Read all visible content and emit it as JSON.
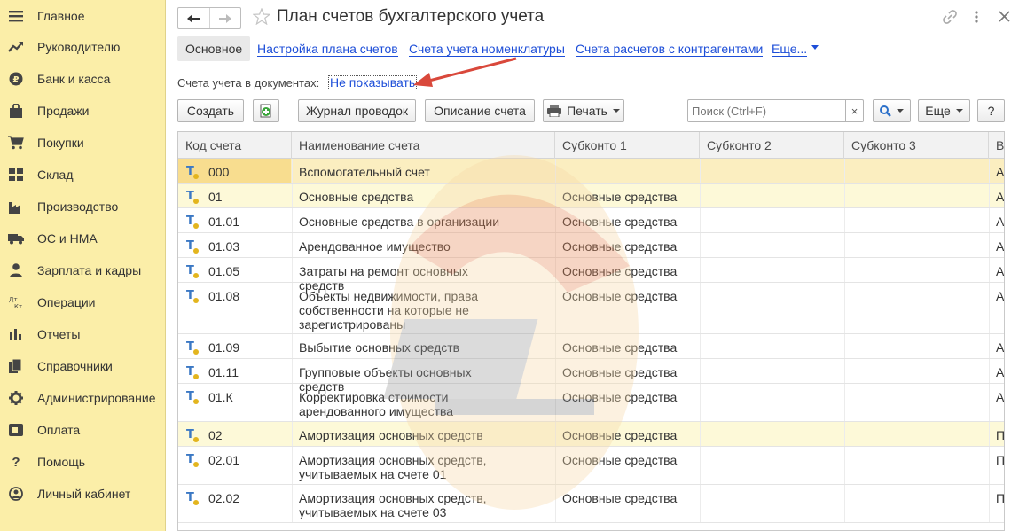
{
  "sidebar": {
    "items": [
      {
        "label": "Главное",
        "icon": "menu-icon"
      },
      {
        "label": "Руководителю",
        "icon": "trend-icon"
      },
      {
        "label": "Банк и касса",
        "icon": "ruble-icon"
      },
      {
        "label": "Продажи",
        "icon": "bag-icon"
      },
      {
        "label": "Покупки",
        "icon": "cart-icon"
      },
      {
        "label": "Склад",
        "icon": "warehouse-icon"
      },
      {
        "label": "Производство",
        "icon": "factory-icon"
      },
      {
        "label": "ОС и НМА",
        "icon": "truck-icon"
      },
      {
        "label": "Зарплата и кадры",
        "icon": "person-icon"
      },
      {
        "label": "Операции",
        "icon": "dt-kt-icon"
      },
      {
        "label": "Отчеты",
        "icon": "bar-chart-icon"
      },
      {
        "label": "Справочники",
        "icon": "books-icon"
      },
      {
        "label": "Администрирование",
        "icon": "gear-icon"
      },
      {
        "label": "Оплата",
        "icon": "card-icon"
      },
      {
        "label": "Помощь",
        "icon": "question-icon"
      },
      {
        "label": "Личный кабинет",
        "icon": "account-icon"
      }
    ]
  },
  "header": {
    "title": "План счетов бухгалтерского учета"
  },
  "tabs": {
    "active": "Основное",
    "links": [
      "Настройка плана счетов",
      "Счета учета номенклатуры",
      "Счета расчетов с контрагентами",
      "Еще..."
    ]
  },
  "accounts_in_docs": {
    "label": "Счета учета в документах:",
    "value": "Не показывать"
  },
  "toolbar": {
    "create": "Создать",
    "journal": "Журнал проводок",
    "description": "Описание счета",
    "print": "Печать",
    "search_placeholder": "Поиск (Ctrl+F)",
    "clear": "×",
    "more": "Еще",
    "help": "?"
  },
  "table": {
    "columns": [
      "Код счета",
      "Наименование счета",
      "Субконто 1",
      "Субконто 2",
      "Субконто 3",
      "В"
    ],
    "rows": [
      {
        "code": "000",
        "name": "Вспомогательный счет",
        "sub1": "",
        "last": "А"
      },
      {
        "code": "01",
        "name": "Основные средства",
        "sub1": "Основные средства",
        "last": "А"
      },
      {
        "code": "01.01",
        "name": "Основные средства в организации",
        "sub1": "Основные средства",
        "last": "А"
      },
      {
        "code": "01.03",
        "name": "Арендованное имущество",
        "sub1": "Основные средства",
        "last": "А"
      },
      {
        "code": "01.05",
        "name": "Затраты на ремонт основных средств",
        "sub1": "Основные средства",
        "last": "А"
      },
      {
        "code": "01.08",
        "name": "Объекты недвижимости, права собственности на которые не зарегистрированы",
        "sub1": "Основные средства",
        "last": "А"
      },
      {
        "code": "01.09",
        "name": "Выбытие основных средств",
        "sub1": "Основные средства",
        "last": "А"
      },
      {
        "code": "01.11",
        "name": "Групповые объекты основных средств",
        "sub1": "Основные средства",
        "last": "А"
      },
      {
        "code": "01.К",
        "name": "Корректировка стоимости арендованного имущества",
        "sub1": "Основные средства",
        "last": "А"
      },
      {
        "code": "02",
        "name": "Амортизация основных средств",
        "sub1": "Основные средства",
        "last": "П"
      },
      {
        "code": "02.01",
        "name": "Амортизация основных средств, учитываемых на счете 01",
        "sub1": "Основные средства",
        "last": "П"
      },
      {
        "code": "02.02",
        "name": "Амортизация основных средств, учитываемых на счете 03",
        "sub1": "Основные средства",
        "last": "П"
      }
    ]
  },
  "colors": {
    "sidebar_bg": "#fbeea8",
    "link": "#1d4ed8",
    "selected_row": "#fbeec0",
    "highlight_row": "#fdf9d8",
    "arrow": "#d9483b"
  }
}
